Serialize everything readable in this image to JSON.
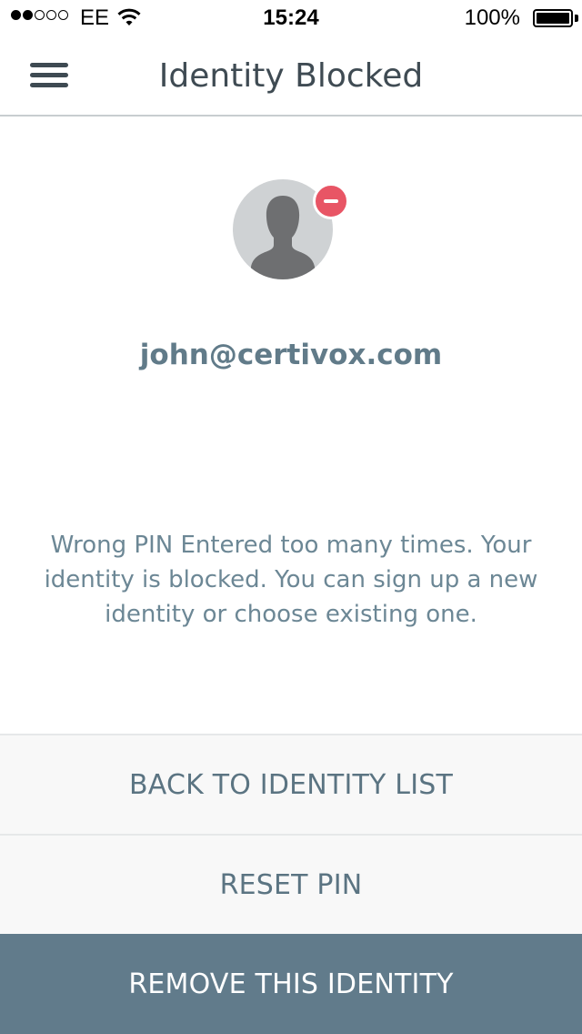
{
  "status_bar": {
    "carrier": "EE",
    "time": "15:24",
    "battery": "100%",
    "signal_bars_filled": 2,
    "signal_bars_total": 5
  },
  "nav": {
    "title": "Identity Blocked",
    "menu_icon": "hamburger-menu-icon"
  },
  "identity": {
    "email": "john@certivox.com",
    "avatar_icon": "user-silhouette-icon",
    "status_badge_icon": "minus-circle-icon",
    "status_badge_color": "#e85565"
  },
  "message": "Wrong PIN Entered too many times. Your identity is blocked. You can sign up a new identity or choose existing one.",
  "actions": {
    "back_label": "BACK TO IDENTITY LIST",
    "reset_label": "RESET PIN",
    "remove_label": "REMOVE THIS IDENTITY"
  },
  "colors": {
    "primary_button": "#617b8b",
    "text_accent": "#617b89",
    "badge": "#e85565"
  }
}
